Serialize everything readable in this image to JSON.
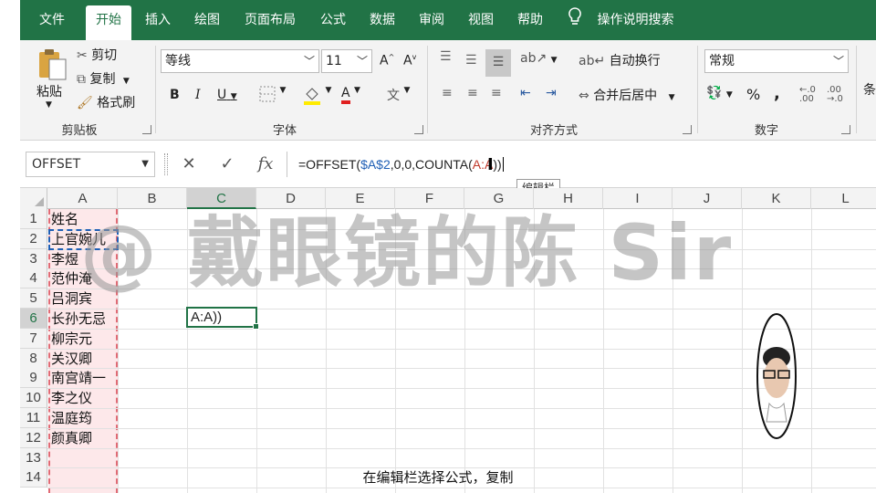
{
  "menu": {
    "tabs": [
      {
        "label": "文件",
        "active": false
      },
      {
        "label": "开始",
        "active": true
      },
      {
        "label": "插入",
        "active": false
      },
      {
        "label": "绘图",
        "active": false
      },
      {
        "label": "页面布局",
        "active": false
      },
      {
        "label": "公式",
        "active": false
      },
      {
        "label": "数据",
        "active": false
      },
      {
        "label": "审阅",
        "active": false
      },
      {
        "label": "视图",
        "active": false
      },
      {
        "label": "帮助",
        "active": false
      }
    ],
    "tell_me": "操作说明搜索"
  },
  "ribbon": {
    "clipboard": {
      "paste": "粘贴",
      "cut": "剪切",
      "copy": "复制",
      "format_painter": "格式刷",
      "label": "剪贴板"
    },
    "font": {
      "name": "等线",
      "size": "11",
      "grow": "A",
      "shrink": "A",
      "bold": "B",
      "italic": "I",
      "underline": "U",
      "font_color_letter": "A",
      "label": "字体"
    },
    "alignment": {
      "wrap_text": "自动换行",
      "merge_center": "合并后居中",
      "label": "对齐方式"
    },
    "number": {
      "format": "常规",
      "percent": "%",
      "comma": ",",
      "label": "数字"
    },
    "styles": {
      "truncated": "条"
    }
  },
  "formula_bar": {
    "name_box": "OFFSET",
    "cancel": "✕",
    "enter": "✓",
    "fx": "fx",
    "formula_parts": {
      "p1": "=OFFSET(",
      "p2": "$A$2",
      "p3": ",0,0,COUNTA(",
      "p4": "A:A",
      "p5": "))"
    },
    "tooltip": "编辑栏"
  },
  "sheet": {
    "columns": [
      "A",
      "B",
      "C",
      "D",
      "E",
      "F",
      "G",
      "H",
      "I",
      "J",
      "K",
      "L"
    ],
    "selected_column": "C",
    "rows": [
      "1",
      "2",
      "3",
      "4",
      "5",
      "6",
      "7",
      "8",
      "9",
      "10",
      "11",
      "12",
      "13",
      "14"
    ],
    "selected_row": "6",
    "column_a": [
      "姓名",
      "上官婉儿",
      "李煜",
      "范仲淹",
      "吕洞宾",
      "长孙无忌",
      "柳宗元",
      "关汉卿",
      "南宫靖一",
      "李之仪",
      "温庭筠",
      "颜真卿",
      "",
      ""
    ],
    "active_cell": {
      "ref": "C6",
      "value": "A:A))"
    }
  },
  "overlay": {
    "watermark": "@ 戴眼镜的陈 Sir",
    "caption": "在编辑栏选择公式，复制"
  },
  "colors": {
    "accent": "#217346",
    "ref_blue": "#1f5fb5",
    "ref_red": "#c0392b",
    "column_highlight": "#fde8ea"
  }
}
